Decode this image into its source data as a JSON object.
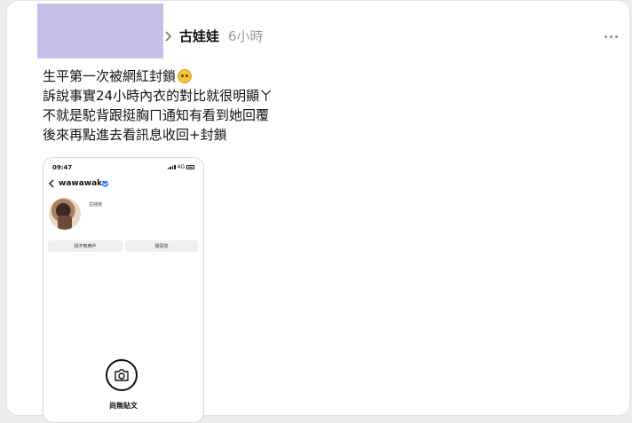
{
  "post": {
    "author": "古娃娃",
    "time": "6小時",
    "lines": [
      "生平第一次被網紅封鎖",
      "訴說事實24小時內衣的對比就很明顯ㄚ",
      "不就是駝背跟挺胸ㄇ通知有看到她回覆",
      "後來再點進去看訊息收回+封鎖"
    ],
    "emoji_icon": "face-emoji-icon",
    "more_icon": "more-dots-icon"
  },
  "embedded_screenshot": {
    "status_time": "09:47",
    "status_network": "4G",
    "username": "wawawaku",
    "display_name": "古娃娃",
    "button_left": "找不到用戶",
    "button_right": "發訊息",
    "empty_state": "尚無貼文",
    "camera_icon": "camera-icon"
  },
  "colors": {
    "avatar_placeholder": "#c7bfe6",
    "background": "#ececec",
    "card": "#ffffff",
    "time_gray": "#999999",
    "verified_blue": "#2f86ff"
  }
}
